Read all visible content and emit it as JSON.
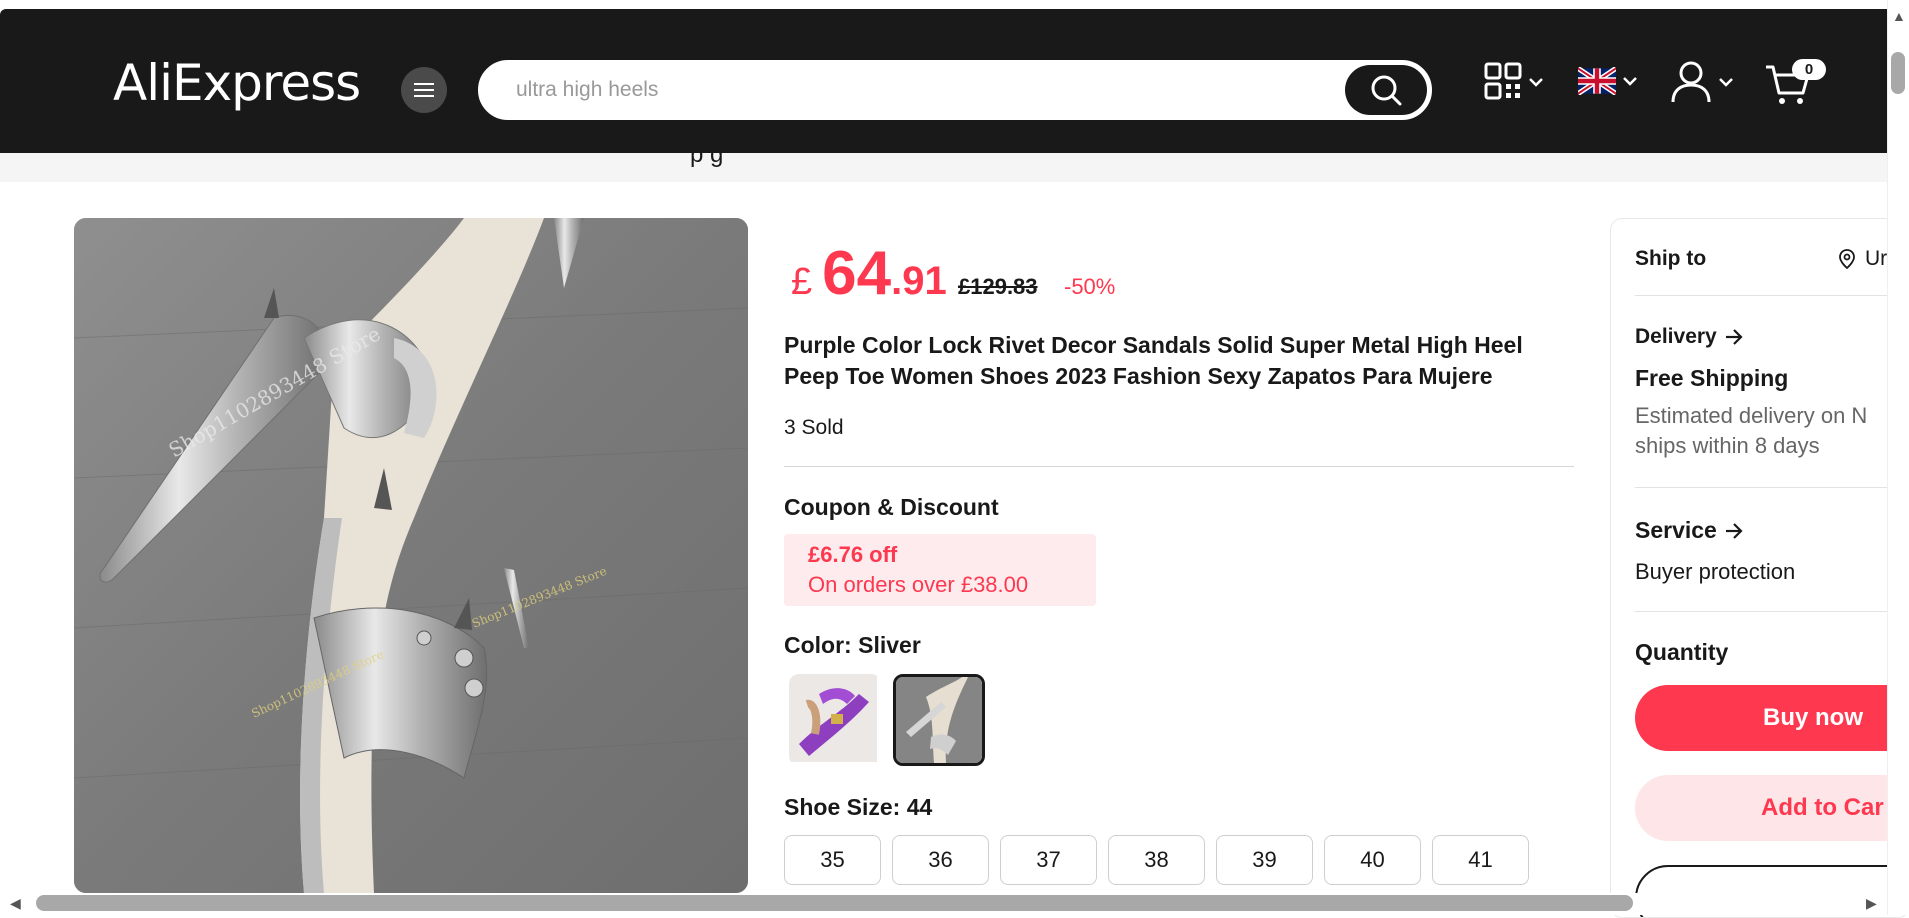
{
  "header": {
    "logo": "AliExpress",
    "search": {
      "value": "",
      "placeholder": "ultra high heels"
    },
    "cart_count": "0"
  },
  "subbar": {
    "text": "p g"
  },
  "product": {
    "price": {
      "currency": "£",
      "whole": "64",
      "cents": ".91",
      "original": "£129.83",
      "discount": "-50%"
    },
    "title": "Purple Color Lock Rivet Decor Sandals Solid Super Metal High Heel Peep Toe Women Shoes 2023 Fashion Sexy Zapatos Para Mujere",
    "sold": "3 Sold",
    "coupon": {
      "heading": "Coupon & Discount",
      "amount": "£6.76 off",
      "condition": "On orders over  £38.00"
    },
    "color": {
      "label": "Color: ",
      "value": "Sliver"
    },
    "size": {
      "label": "Shoe Size: ",
      "value": "44",
      "options": [
        "35",
        "36",
        "37",
        "38",
        "39",
        "40",
        "41"
      ]
    },
    "watermark": [
      "Shop1102893448 Store",
      "Shop1102893448 Store",
      "Shop1102893448 Store"
    ]
  },
  "side": {
    "ship_to": "Ship to",
    "ship_dest": "Ur",
    "delivery": "Delivery",
    "free_shipping": "Free Shipping",
    "estimate_line1": "Estimated delivery on N",
    "estimate_line2": "ships within 8 days",
    "service": "Service",
    "buyer_protection": "Buyer protection",
    "quantity": "Quantity",
    "buy_now": "Buy now",
    "add_to_cart": "Add to Car"
  },
  "colors": {
    "brand_red": "#fd384f",
    "header_bg": "#191919"
  }
}
